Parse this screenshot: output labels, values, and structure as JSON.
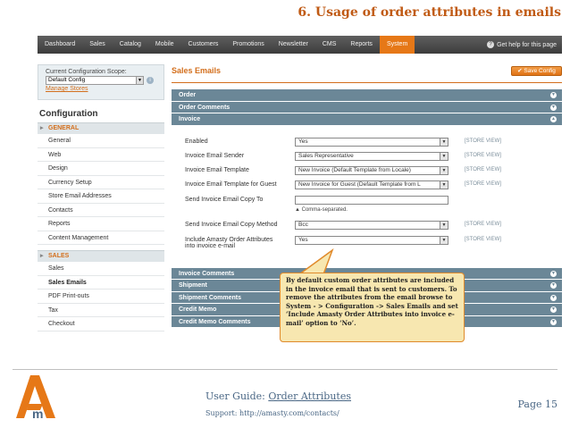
{
  "slide_title": "6. Usage of order attributes in emails",
  "nav": {
    "items": [
      "Dashboard",
      "Sales",
      "Catalog",
      "Mobile",
      "Customers",
      "Promotions",
      "Newsletter",
      "CMS",
      "Reports",
      "System"
    ],
    "active_index": 9,
    "help_label": "Get help for this page"
  },
  "sidebar": {
    "scope_label": "Current Configuration Scope:",
    "scope_value": "Default Config",
    "manage_stores": "Manage Stores",
    "config_title": "Configuration",
    "general_group": "GENERAL",
    "general_items": [
      "General",
      "Web",
      "Design",
      "Currency Setup",
      "Store Email Addresses",
      "Contacts",
      "Reports",
      "Content Management"
    ],
    "sales_group": "SALES",
    "sales_items": [
      "Sales",
      "Sales Emails",
      "PDF Print-outs",
      "Tax",
      "Checkout"
    ],
    "active_item": "Sales Emails"
  },
  "main": {
    "title": "Sales Emails",
    "save_label": "Save Config",
    "top_sections": [
      "Order",
      "Order Comments",
      "Invoice"
    ],
    "fields": [
      {
        "label": "Enabled",
        "value": "Yes",
        "scope": "[STORE VIEW]"
      },
      {
        "label": "Invoice Email Sender",
        "value": "Sales Representative",
        "scope": "[STORE VIEW]"
      },
      {
        "label": "Invoice Email Template",
        "value": "New Invoice (Default Template from Locale)",
        "scope": "[STORE VIEW]"
      },
      {
        "label": "Invoice Email Template for Guest",
        "value": "New Invoice for Guest (Default Template from L",
        "scope": "[STORE VIEW]"
      },
      {
        "label": "Send Invoice Email Copy To",
        "value": "",
        "note": "▲ Comma-separated.",
        "scope": ""
      },
      {
        "label": "Send Invoice Email Copy Method",
        "value": "Bcc",
        "scope": "[STORE VIEW]"
      },
      {
        "label": "Include Amasty Order Attributes",
        "label2": "into invoice e-mail",
        "value": "Yes",
        "scope": "[STORE VIEW]"
      }
    ],
    "bottom_sections": [
      "Invoice Comments",
      "Shipment",
      "Shipment Comments",
      "Credit Memo",
      "Credit Memo Comments"
    ]
  },
  "callout": "By default custom order attributes are included in the invoice email that is sent to customers. To remove the attributes from the email browse to System - > Configuration -> Sales Emails and set ‘Include Amasty Order Attributes into invoice e-mail’ option to ‘No’.",
  "footer": {
    "guide_prefix": "User Guide: ",
    "guide_link": "Order Attributes",
    "support": "Support: http://amasty.com/contacts/",
    "page": "Page 15"
  },
  "colors": {
    "accent": "#e67817",
    "section_bar": "#6b8797",
    "footer_text": "#4a6785",
    "callout_bg": "#f7e7b0"
  }
}
